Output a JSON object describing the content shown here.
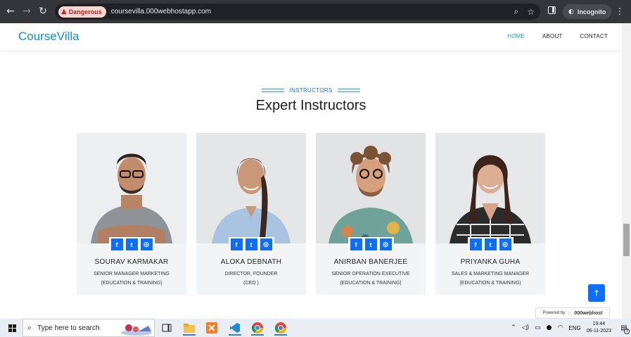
{
  "browser": {
    "security_label": "Dangerous",
    "url": "coursevilla.000webhostapp.com",
    "incognito_label": "Incognito"
  },
  "site": {
    "logo": "CourseVilla",
    "menu": [
      {
        "label": "HOME",
        "active": true
      },
      {
        "label": "ABOUT",
        "active": false
      },
      {
        "label": "CONTACT",
        "active": false
      }
    ]
  },
  "section": {
    "subtitle": "INSTRUCTORS",
    "title": "Expert Instructors"
  },
  "instructors": [
    {
      "name": "SOURAV KARMAKAR",
      "role_line1": "SENIOR MANAGER MARKETING",
      "role_line2": "(EDUCATION & TRAINING)"
    },
    {
      "name": "ALOKA DEBNATH",
      "role_line1": "DIRECTOR, FOUNDER",
      "role_line2": "(CEO )"
    },
    {
      "name": "ANIRBAN BANERJEE",
      "role_line1": "SENIOR OPERATION EXECUTIVE",
      "role_line2": "(EDUCATION & TRAINING)"
    },
    {
      "name": "PRIYANKA GUHA",
      "role_line1": "SALES & MARKETING MANAGER",
      "role_line2": "(EDUCATION & TRAINING)"
    }
  ],
  "social_icons": [
    "facebook-icon",
    "twitter-icon",
    "instagram-icon"
  ],
  "powered_by": {
    "prefix": "Powered by",
    "brand": "000webhost"
  },
  "taskbar": {
    "search_placeholder": "Type here to search",
    "language": "ENG",
    "time": "19:44",
    "date": "06-11-2023",
    "notification_count": "3"
  },
  "colors": {
    "accent": "#0d6efd",
    "logo": "#0d8fd0",
    "teal": "#17a2c8",
    "danger": "#c5221f"
  }
}
